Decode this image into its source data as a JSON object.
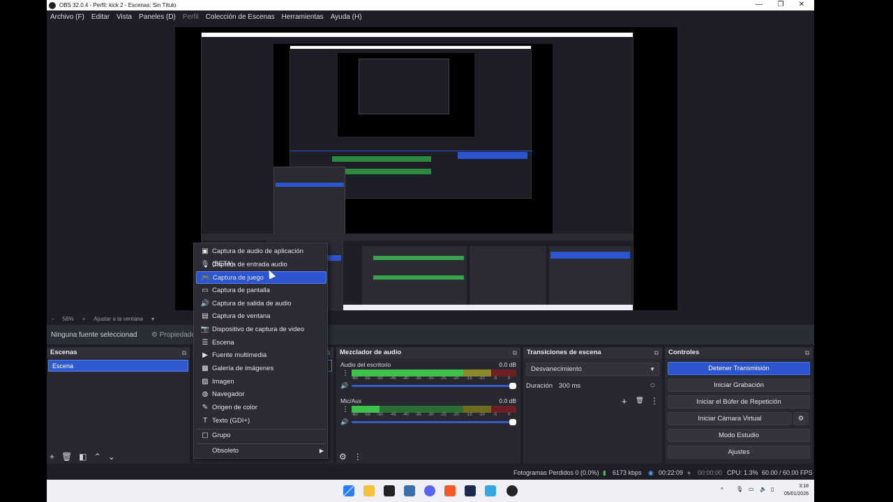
{
  "window": {
    "title": "OBS 32.0.4 - Perfil: kick 2 - Escenas: Sin Título",
    "controls": {
      "minimize": "—",
      "maximize": "❐",
      "close": "✕"
    }
  },
  "menubar": [
    "Archivo (F)",
    "Editar",
    "Vista",
    "Paneles (D)",
    "Perfil",
    "Colección de Escenas",
    "Herramientas",
    "Ayuda (H)"
  ],
  "zoom": {
    "minus": "−",
    "value": "56%",
    "plus": "+",
    "fit": "Ajustar a la ventana"
  },
  "source_toolbar": {
    "no_source": "Ninguna fuente seleccionad",
    "properties": "Propiedades"
  },
  "docks": {
    "scenes": {
      "title": "Escenas",
      "items": [
        "Escena"
      ]
    },
    "mixer": {
      "title": "Mezclador de audio",
      "tracks": [
        {
          "name": "Audio del escritorio",
          "db": "0.0 dB"
        },
        {
          "name": "Mic/Aux",
          "db": "0.0 dB"
        }
      ],
      "scale": [
        "-60",
        "-55",
        "-50",
        "-45",
        "-40",
        "-35",
        "-30",
        "-25",
        "-20",
        "-15",
        "-10",
        "-5",
        "0"
      ]
    },
    "transitions": {
      "title": "Transiciones de escena",
      "transition": "Desvanecimiento",
      "duration_label": "Duración",
      "duration_value": "300 ms"
    },
    "controls": {
      "title": "Controles",
      "buttons": [
        "Detener Transmisión",
        "Iniciar Grabación",
        "Iniciar el Búfer de Repetición",
        "Iniciar Cámara Virtual",
        "Modo Estudio",
        "Ajustes"
      ]
    }
  },
  "context_menu": {
    "items": [
      {
        "label": "Captura de audio de aplicación (BETA)",
        "icon": "app-audio-icon"
      },
      {
        "label": "Captura de entrada audio",
        "icon": "microphone-icon"
      },
      {
        "label": "Captura de juego",
        "icon": "gamepad-icon",
        "selected": true
      },
      {
        "label": "Captura de pantalla",
        "icon": "monitor-icon"
      },
      {
        "label": "Captura de salida de audio",
        "icon": "speaker-icon"
      },
      {
        "label": "Captura de ventana",
        "icon": "window-icon"
      },
      {
        "label": "Dispositivo de captura de video",
        "icon": "camera-icon"
      },
      {
        "label": "Escena",
        "icon": "list-icon"
      },
      {
        "label": "Fuente multimedia",
        "icon": "play-icon"
      },
      {
        "label": "Galería de imágenes",
        "icon": "images-icon"
      },
      {
        "label": "Imagen",
        "icon": "image-icon"
      },
      {
        "label": "Navegador",
        "icon": "globe-icon"
      },
      {
        "label": "Origen de color",
        "icon": "brush-icon"
      },
      {
        "label": "Texto (GDI+)",
        "icon": "text-icon"
      }
    ],
    "group": "Grupo",
    "deprecated": "Obsoleto"
  },
  "statusbar": {
    "dropped": "Fotogramas Perdidos 0 (0.0%)",
    "bitrate": "6173 kbps",
    "stream_time": "00:22:09",
    "rec_time": "00:00:00",
    "cpu": "CPU: 1.3%",
    "fps": "60.00 / 60.00 FPS"
  },
  "taskbar": {
    "time": "3:18",
    "date": "05/01/2026"
  },
  "colors": {
    "accent": "#2e55d0",
    "dock_bg": "#272830",
    "window_bg": "#1e1f26"
  }
}
